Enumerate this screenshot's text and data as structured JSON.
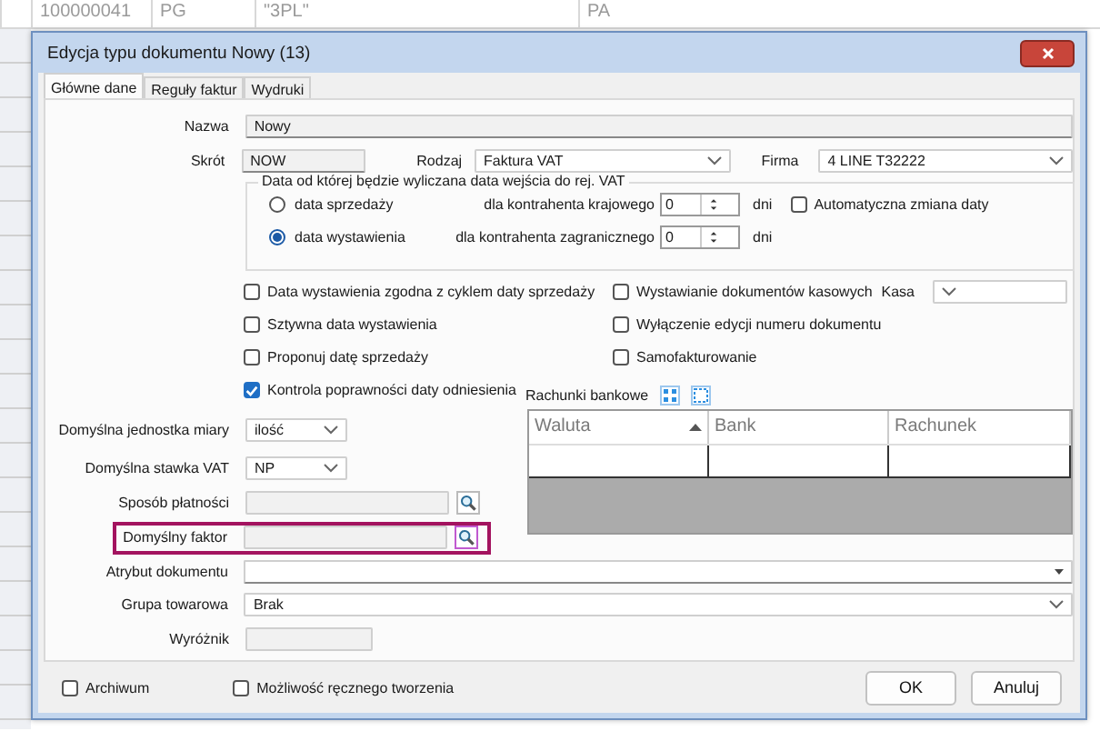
{
  "background_table": {
    "rows": [
      {
        "cells": [
          "100000041",
          "PG",
          "\"3PL\"",
          "PA"
        ]
      }
    ]
  },
  "window": {
    "title": "Edycja typu dokumentu  Nowy (13)"
  },
  "tabs": [
    {
      "label": "Główne dane",
      "selected": true
    },
    {
      "label": "Reguły faktur",
      "selected": false
    },
    {
      "label": "Wydruki",
      "selected": false
    }
  ],
  "name": {
    "label": "Nazwa",
    "value": "Nowy"
  },
  "short": {
    "label": "Skrót",
    "value": "NOW"
  },
  "type": {
    "label": "Rodzaj",
    "value": "Faktura VAT"
  },
  "company": {
    "label": "Firma",
    "value": "4 LINE T32222"
  },
  "vat_date_group": {
    "legend": "Data od której będzie wyliczana data wejścia do rej. VAT",
    "options": [
      {
        "label": "data sprzedaży",
        "selected": false,
        "offset_label": "dla kontrahenta krajowego",
        "value": "0",
        "unit": "dni"
      },
      {
        "label": "data wystawienia",
        "selected": true,
        "offset_label": "dla kontrahenta zagranicznego",
        "value": "0",
        "unit": "dni"
      }
    ],
    "auto_change": {
      "label": "Automatyczna zmiana daty",
      "checked": false
    }
  },
  "options_left": [
    {
      "label": "Data wystawienia zgodna z cyklem daty sprzedaży",
      "checked": false
    },
    {
      "label": "Sztywna data wystawienia",
      "checked": false
    },
    {
      "label": "Proponuj datę sprzedaży",
      "checked": false
    },
    {
      "label": "Kontrola poprawności daty odniesienia",
      "checked": true
    }
  ],
  "options_right": [
    {
      "label": "Wystawianie dokumentów kasowych",
      "checked": false
    },
    {
      "label": "Wyłączenie edycji numeru dokumentu",
      "checked": false
    },
    {
      "label": "Samofakturowanie",
      "checked": false
    }
  ],
  "cash_register": {
    "label": "Kasa"
  },
  "default_unit": {
    "label": "Domyślna jednostka miary",
    "value": "ilość"
  },
  "default_vat": {
    "label": "Domyślna stawka VAT",
    "value": "NP"
  },
  "payment_method": {
    "label": "Sposób płatności"
  },
  "default_factor": {
    "label": "Domyślny faktor",
    "highlighted": true
  },
  "bank_accounts": {
    "label": "Rachunki bankowe",
    "columns": [
      {
        "label": "Waluta",
        "sorted": true
      },
      {
        "label": "Bank",
        "sorted": false
      },
      {
        "label": "Rachunek",
        "sorted": false
      }
    ]
  },
  "document_attribute": {
    "label": "Atrybut dokumentu"
  },
  "product_group": {
    "label": "Grupa towarowa",
    "value": "Brak"
  },
  "marker": {
    "label": "Wyróżnik"
  },
  "footer_options": [
    {
      "label": "Archiwum",
      "checked": false
    },
    {
      "label": "Możliwość ręcznego tworzenia",
      "checked": false
    }
  ],
  "buttons": [
    {
      "label": "OK"
    },
    {
      "label": "Anuluj"
    }
  ]
}
